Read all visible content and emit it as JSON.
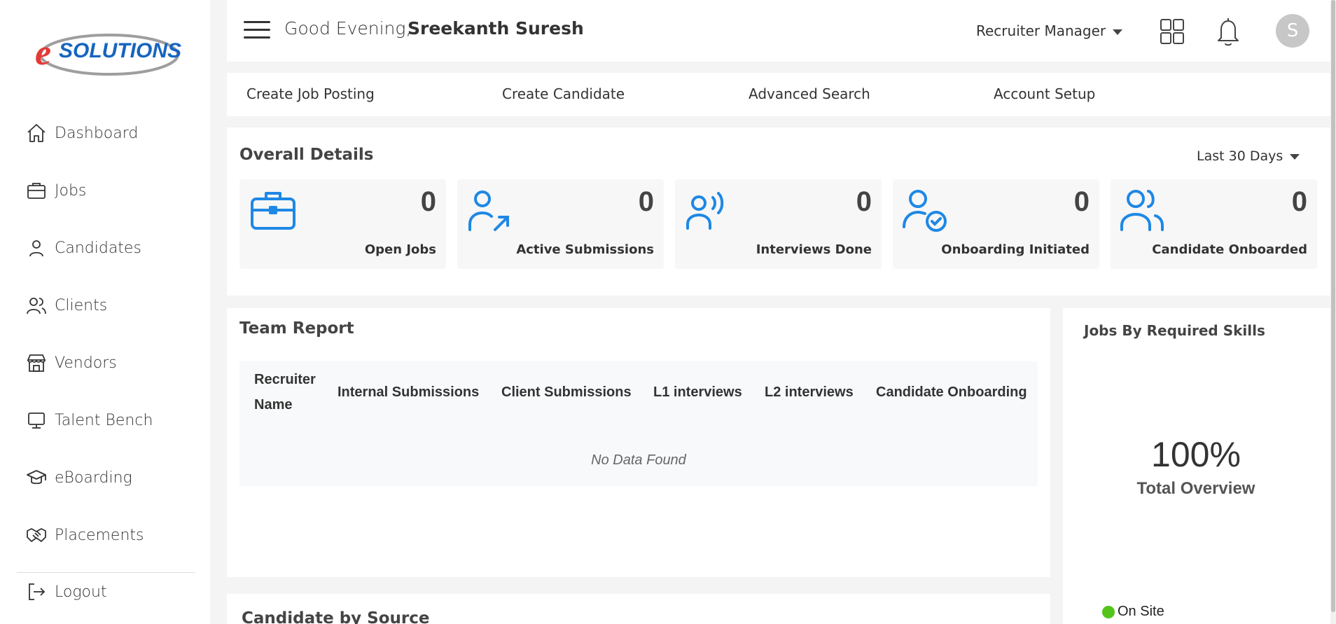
{
  "brand": {
    "logo_text": "eSOLUTIONS",
    "accent": "#1e88e5"
  },
  "sidebar": {
    "items": [
      {
        "label": "Dashboard",
        "icon": "home-icon"
      },
      {
        "label": "Jobs",
        "icon": "briefcase-icon"
      },
      {
        "label": "Candidates",
        "icon": "user-icon"
      },
      {
        "label": "Clients",
        "icon": "users-icon"
      },
      {
        "label": "Vendors",
        "icon": "store-icon"
      },
      {
        "label": "Talent Bench",
        "icon": "monitor-icon"
      },
      {
        "label": "eBoarding",
        "icon": "graduation-cap-icon"
      },
      {
        "label": "Placements",
        "icon": "handshake-icon"
      }
    ],
    "logout_label": "Logout"
  },
  "header": {
    "greeting": "Good Evening,",
    "user_name": "Sreekanth Suresh",
    "role": "Recruiter Manager",
    "avatar_initial": "S"
  },
  "quick_links": [
    "Create Job Posting",
    "Create Candidate",
    "Advanced Search",
    "Account Setup"
  ],
  "overall": {
    "title": "Overall Details",
    "period": "Last 30 Days",
    "cards": [
      {
        "value": "0",
        "label": "Open Jobs",
        "icon": "briefcase-icon"
      },
      {
        "value": "0",
        "label": "Active Submissions",
        "icon": "user-arrow-icon"
      },
      {
        "value": "0",
        "label": "Interviews Done",
        "icon": "user-voice-icon"
      },
      {
        "value": "0",
        "label": "Onboarding Initiated",
        "icon": "user-check-icon"
      },
      {
        "value": "0",
        "label": "Candidate Onboarded",
        "icon": "users-icon"
      }
    ]
  },
  "team_report": {
    "title": "Team Report",
    "columns": [
      "Recruiter Name",
      "Internal Submissions",
      "Client Submissions",
      "L1 interviews",
      "L2 interviews",
      "Candidate Onboarding"
    ],
    "empty_text": "No Data Found"
  },
  "candidate_by_source": {
    "title": "Candidate by Source"
  },
  "skills": {
    "title": "Jobs By Required Skills",
    "percent": "100%",
    "percent_label": "Total Overview",
    "legend": [
      {
        "label": "On Site",
        "color": "#52c41a"
      }
    ]
  }
}
